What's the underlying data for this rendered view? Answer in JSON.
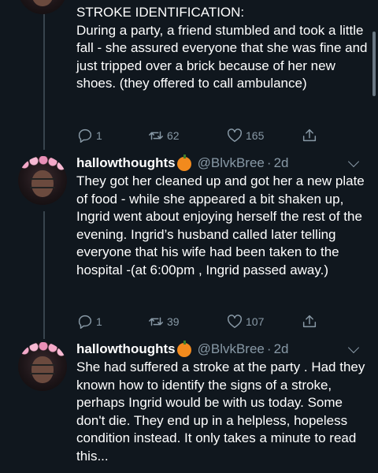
{
  "tweets": [
    {
      "text": "STROKE IDENTIFICATION:\nDuring a party, a friend stumbled and took a little fall - she assured everyone that she was fine and just tripped over a brick because of her new shoes. (they offered to call ambulance)",
      "replies": "1",
      "retweets": "62",
      "likes": "165"
    },
    {
      "display_name": "hallowthoughts",
      "handle": "@BlvkBree",
      "separator": "·",
      "time": "2d",
      "text": "They got her cleaned up and got her a new plate of food - while she appeared a bit shaken up, Ingrid went about enjoying herself the rest of the evening. Ingrid’s husband called later telling everyone that his wife had been taken to the hospital -(at 6:00pm , Ingrid passed away.)",
      "replies": "1",
      "retweets": "39",
      "likes": "107"
    },
    {
      "display_name": "hallowthoughts",
      "handle": "@BlvkBree",
      "separator": "·",
      "time": "2d",
      "text": "She had suffered a stroke at the party . Had they known how to identify the signs of a stroke, perhaps Ingrid would be with us today. Some don't die. They end up in a helpless, hopeless condition instead. It only takes a minute to read this..."
    }
  ],
  "icons": {
    "reply": "reply-icon",
    "retweet": "retweet-icon",
    "like": "heart-icon",
    "share": "share-icon",
    "more": "chevron-down-icon",
    "emoji": "jack-o-lantern-emoji"
  },
  "colors": {
    "background": "#10171e",
    "text": "#ffffff",
    "secondary": "#8899a6",
    "thread_line": "#38444d"
  }
}
